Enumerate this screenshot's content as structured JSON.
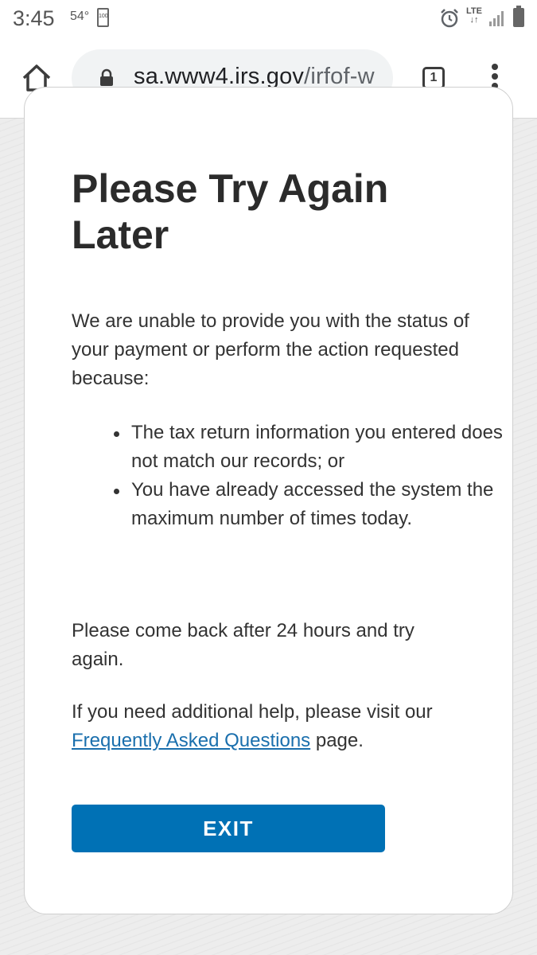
{
  "status_bar": {
    "time": "3:45",
    "temperature": "54°",
    "battery_small_label": "100",
    "network": "LTE"
  },
  "browser": {
    "url_host": "sa.www4.irs.gov",
    "url_path": "/irfof-w",
    "tab_count": "1"
  },
  "page": {
    "title": "Please Try Again Later",
    "intro": "We are unable to provide you with the status of your payment or perform the action requested because:",
    "reasons": [
      "The tax return information you entered does not match our records; or",
      "You have already accessed the system the maximum number of times today."
    ],
    "retry_text": "Please come back after 24 hours and try again.",
    "help_text_before": "If you need additional help, please visit our ",
    "help_link": "Frequently Asked Questions",
    "help_text_after": " page.",
    "exit_label": "EXIT"
  },
  "colors": {
    "button": "#0071b5",
    "link": "#1a6fad",
    "title": "#2b2b2b"
  }
}
